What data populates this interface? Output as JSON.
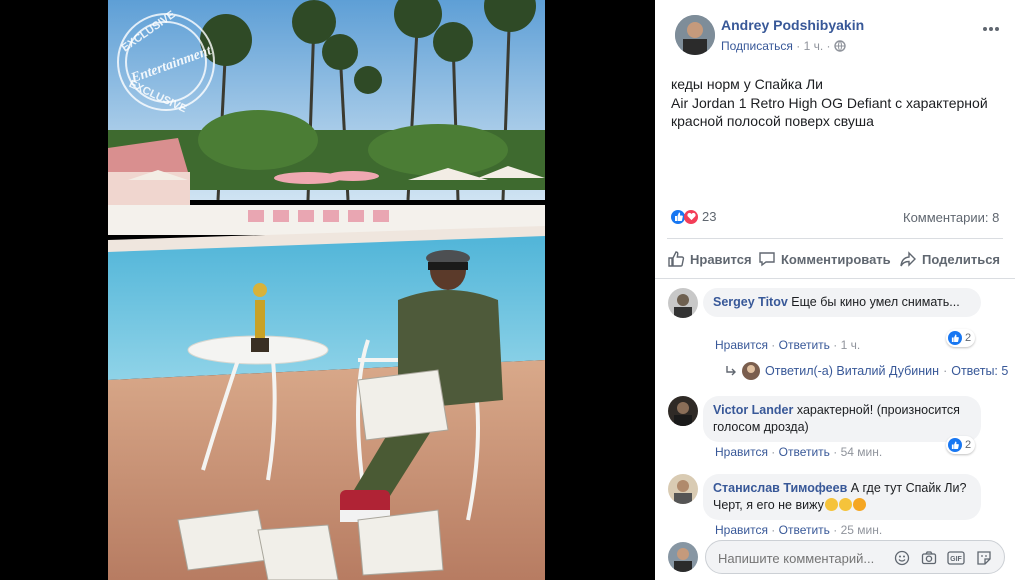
{
  "post": {
    "author": "Andrey Podshibyakin",
    "subscribe": "Подписаться",
    "sep": "·",
    "time": "1 ч.",
    "text_lines": [
      "кеды норм у Спайка Ли",
      "Air Jordan 1 Retro High OG Defiant с характерной",
      "красной полосой поверх свуша"
    ],
    "reaction_count": "23",
    "comments_count": "Комментарии: 8",
    "more_icon": "more-dots-icon"
  },
  "photo": {
    "watermark_top": "EXCLUSIVE",
    "watermark_mid": "Entertainment",
    "watermark_bottom": "EXCLUSIVE"
  },
  "actions": {
    "like": "Нравится",
    "comment": "Комментировать",
    "share": "Поделиться"
  },
  "comments": [
    {
      "author": "Sergey Titov",
      "text": "Еще бы кино умел снимать...",
      "like": "Нравится",
      "reply": "Ответить",
      "time": "1 ч.",
      "reactions": "2"
    },
    {
      "author": "Victor Lander",
      "text": "характерной! (произносится голосом дрозда)",
      "like": "Нравится",
      "reply": "Ответить",
      "time": "54 мин.",
      "reactions": "2"
    },
    {
      "author": "Станислав Тимофеев",
      "text": "А где тут Спайк Ли? Черт, я его не вижу",
      "like": "Нравится",
      "reply": "Ответить",
      "time": "25 мин."
    }
  ],
  "reply_summary": {
    "author_text": "Ответил(-а) Виталий Дубинин",
    "sep": "·",
    "replies": "Ответы: 5"
  },
  "composer": {
    "placeholder": "Напишите комментарий..."
  }
}
